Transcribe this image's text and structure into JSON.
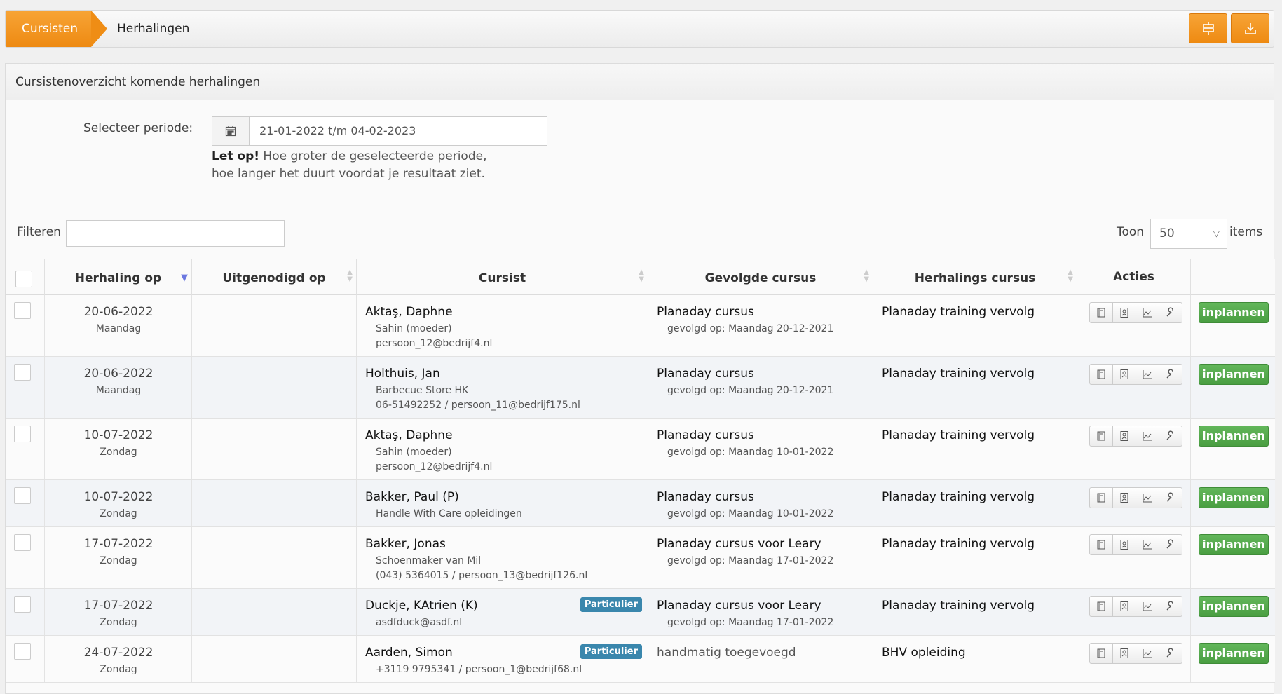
{
  "breadcrumb": {
    "section": "Cursisten",
    "page": "Herhalingen"
  },
  "toolbar": {
    "filter_icon": "signpost-icon",
    "export_icon": "download-icon"
  },
  "panel": {
    "title": "Cursistenoverzicht komende herhalingen"
  },
  "period": {
    "label": "Selecteer periode:",
    "value": "21-01-2022 t/m 04-02-2023",
    "notice_bold": "Let op!",
    "notice_line1": " Hoe groter de geselecteerde periode,",
    "notice_line2": "hoe langer het duurt voordat je resultaat ziet."
  },
  "filter": {
    "label": "Filteren",
    "value": ""
  },
  "paging": {
    "toon_label": "Toon",
    "page_size": "50",
    "items_label": "items"
  },
  "table": {
    "headers": {
      "herhaling_op": "Herhaling op",
      "uitgenodigd_op": "Uitgenodigd op",
      "cursist": "Cursist",
      "gevolgde_cursus": "Gevolgde cursus",
      "herhalings_cursus": "Herhalings cursus",
      "acties": "Acties"
    },
    "plan_label": "inplannen",
    "rows": [
      {
        "date": "20-06-2022",
        "day": "Maandag",
        "name": "Aktaş, Daphne",
        "line1": "Sahin (moeder)",
        "line2": "persoon_12@bedrijf4.nl",
        "badge": "",
        "course": "Planaday cursus",
        "followed": "gevolgd op: Maandag 20-12-2021",
        "repeat": "Planaday training vervolg"
      },
      {
        "date": "20-06-2022",
        "day": "Maandag",
        "name": "Holthuis, Jan",
        "line1": "Barbecue Store HK",
        "line2": "06-51492252 / persoon_11@bedrijf175.nl",
        "badge": "",
        "course": "Planaday cursus",
        "followed": "gevolgd op: Maandag 20-12-2021",
        "repeat": "Planaday training vervolg"
      },
      {
        "date": "10-07-2022",
        "day": "Zondag",
        "name": "Aktaş, Daphne",
        "line1": "Sahin (moeder)",
        "line2": "persoon_12@bedrijf4.nl",
        "badge": "",
        "course": "Planaday cursus",
        "followed": "gevolgd op: Maandag 10-01-2022",
        "repeat": "Planaday training vervolg"
      },
      {
        "date": "10-07-2022",
        "day": "Zondag",
        "name": "Bakker, Paul (P)",
        "line1": "Handle With Care opleidingen",
        "line2": "",
        "badge": "",
        "course": "Planaday cursus",
        "followed": "gevolgd op: Maandag 10-01-2022",
        "repeat": "Planaday training vervolg"
      },
      {
        "date": "17-07-2022",
        "day": "Zondag",
        "name": "Bakker, Jonas",
        "line1": "Schoenmaker van Mil",
        "line2": "(043) 5364015 / persoon_13@bedrijf126.nl",
        "badge": "",
        "course": "Planaday cursus voor Leary",
        "followed": "gevolgd op: Maandag 17-01-2022",
        "repeat": "Planaday training vervolg"
      },
      {
        "date": "17-07-2022",
        "day": "Zondag",
        "name": "Duckje, KAtrien (K)",
        "line1": "asdfduck@asdf.nl",
        "line2": "",
        "badge": "Particulier",
        "course": "Planaday cursus voor Leary",
        "followed": "gevolgd op: Maandag 17-01-2022",
        "repeat": "Planaday training vervolg"
      },
      {
        "date": "24-07-2022",
        "day": "Zondag",
        "name": "Aarden, Simon",
        "line1": "+3119 9795341 / persoon_1@bedrijf68.nl",
        "line2": "",
        "badge": "Particulier",
        "course": "handmatig toegevoegd",
        "followed": "",
        "repeat": "BHV opleiding"
      }
    ]
  },
  "colors": {
    "accent": "#f39a20",
    "success": "#4fa547",
    "badge": "#3a87ad"
  }
}
